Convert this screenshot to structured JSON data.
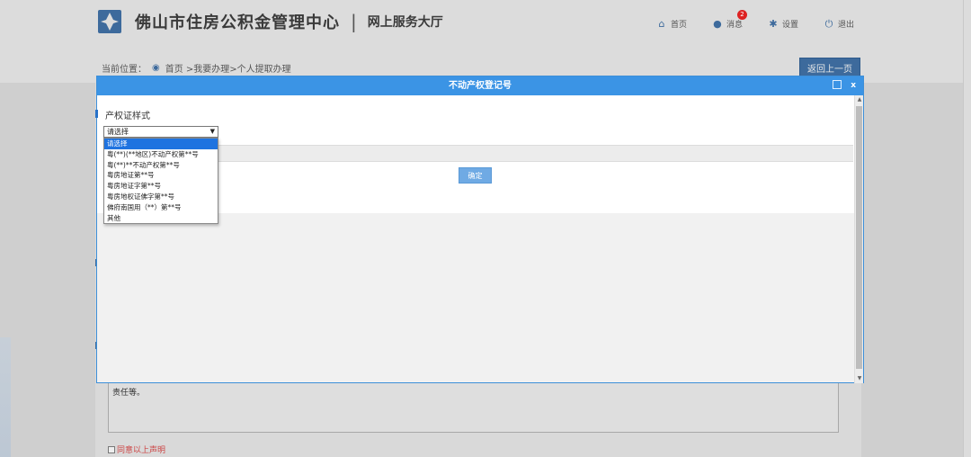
{
  "header": {
    "title": "佛山市住房公积金管理中心",
    "separator": "|",
    "subtitle": "网上服务大厅"
  },
  "nav": {
    "items": [
      {
        "label": "首页",
        "icon": "home-icon"
      },
      {
        "label": "消息",
        "icon": "message-icon",
        "badge": "2"
      },
      {
        "label": "设置",
        "icon": "gear-icon"
      },
      {
        "label": "退出",
        "icon": "power-icon"
      }
    ]
  },
  "breadcrumb": {
    "prefix": "当前位置：",
    "path": "首页 >我要办理>个人提取办理"
  },
  "back_button": "返回上一页",
  "modal": {
    "title": "不动产权登记号",
    "close": "x",
    "section_title": "产权证样式",
    "select_value": "请选择",
    "confirm": "确定",
    "options": [
      "请选择",
      "粤(**)(**地区)不动产权第**号",
      "粤(**)**不动产权第**号",
      "粤房地证第**号",
      "粤房地证字第**号",
      "粤房地权证佛字第**号",
      "佛府南国用（**）第**号",
      "其他"
    ]
  },
  "background": {
    "textarea_text": "责任等。",
    "checkbox_label": "同意以上声明"
  },
  "colors": {
    "accent": "#3b94e5",
    "selected": "#1e73e0",
    "brand": "#3d6a9c"
  }
}
